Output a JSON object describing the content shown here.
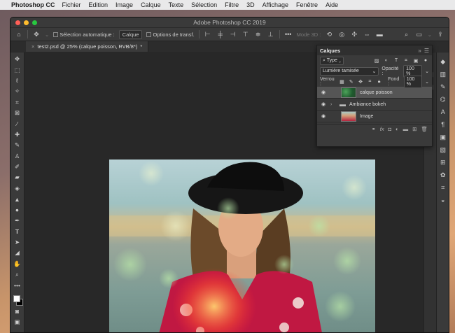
{
  "menubar": {
    "apple": "",
    "app": "Photoshop CC",
    "items": [
      "Fichier",
      "Edition",
      "Image",
      "Calque",
      "Texte",
      "Sélection",
      "Filtre",
      "3D",
      "Affichage",
      "Fenêtre",
      "Aide"
    ]
  },
  "window": {
    "title": "Adobe Photoshop CC 2019"
  },
  "options": {
    "auto_select_label": "Sélection automatique :",
    "auto_select_value": "Calque",
    "transform_label": "Options de transf.",
    "mode3d_label": "Mode 3D :"
  },
  "document": {
    "tab_label": "test2.psd @ 25% (calque poisson, RVB/8*)",
    "tab_modified": "*",
    "tab_close": "×"
  },
  "layers_panel": {
    "title": "Calques",
    "filter_label": "Type",
    "blend_mode": "Lumière tamisée",
    "opacity_label": "Opacité :",
    "opacity_value": "100 %",
    "lock_label": "Verrou :",
    "fill_label": "Fond :",
    "fill_value": "100 %",
    "layers": [
      {
        "name": "calque poisson",
        "active": true
      },
      {
        "name": "Ambiance bokeh",
        "active": false
      },
      {
        "name": "Image",
        "active": false
      }
    ]
  },
  "colors": {
    "close": "#ff5f57",
    "minimize": "#febc2e",
    "zoom": "#28c840"
  }
}
